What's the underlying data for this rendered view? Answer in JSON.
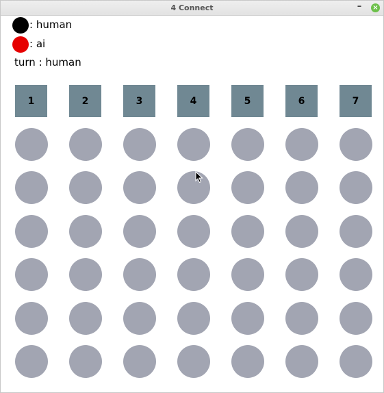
{
  "window": {
    "title": "4 Connect",
    "minimize_label": "–",
    "close_icon": "close-icon",
    "close_glyph": "×"
  },
  "legend": [
    {
      "player": "human",
      "label": ": human",
      "color": "#000000"
    },
    {
      "player": "ai",
      "label": ": ai",
      "color": "#e60000"
    }
  ],
  "turn": {
    "label": "turn : human"
  },
  "columns": [
    "1",
    "2",
    "3",
    "4",
    "5",
    "6",
    "7"
  ],
  "board": {
    "rows": 6,
    "cols": 7,
    "empty_color": "#a2a5b2",
    "cells": [
      [
        "empty",
        "empty",
        "empty",
        "empty",
        "empty",
        "empty",
        "empty"
      ],
      [
        "empty",
        "empty",
        "empty",
        "empty",
        "empty",
        "empty",
        "empty"
      ],
      [
        "empty",
        "empty",
        "empty",
        "empty",
        "empty",
        "empty",
        "empty"
      ],
      [
        "empty",
        "empty",
        "empty",
        "empty",
        "empty",
        "empty",
        "empty"
      ],
      [
        "empty",
        "empty",
        "empty",
        "empty",
        "empty",
        "empty",
        "empty"
      ],
      [
        "empty",
        "empty",
        "empty",
        "empty",
        "empty",
        "empty",
        "empty"
      ]
    ]
  },
  "column_button_color": "#708893"
}
